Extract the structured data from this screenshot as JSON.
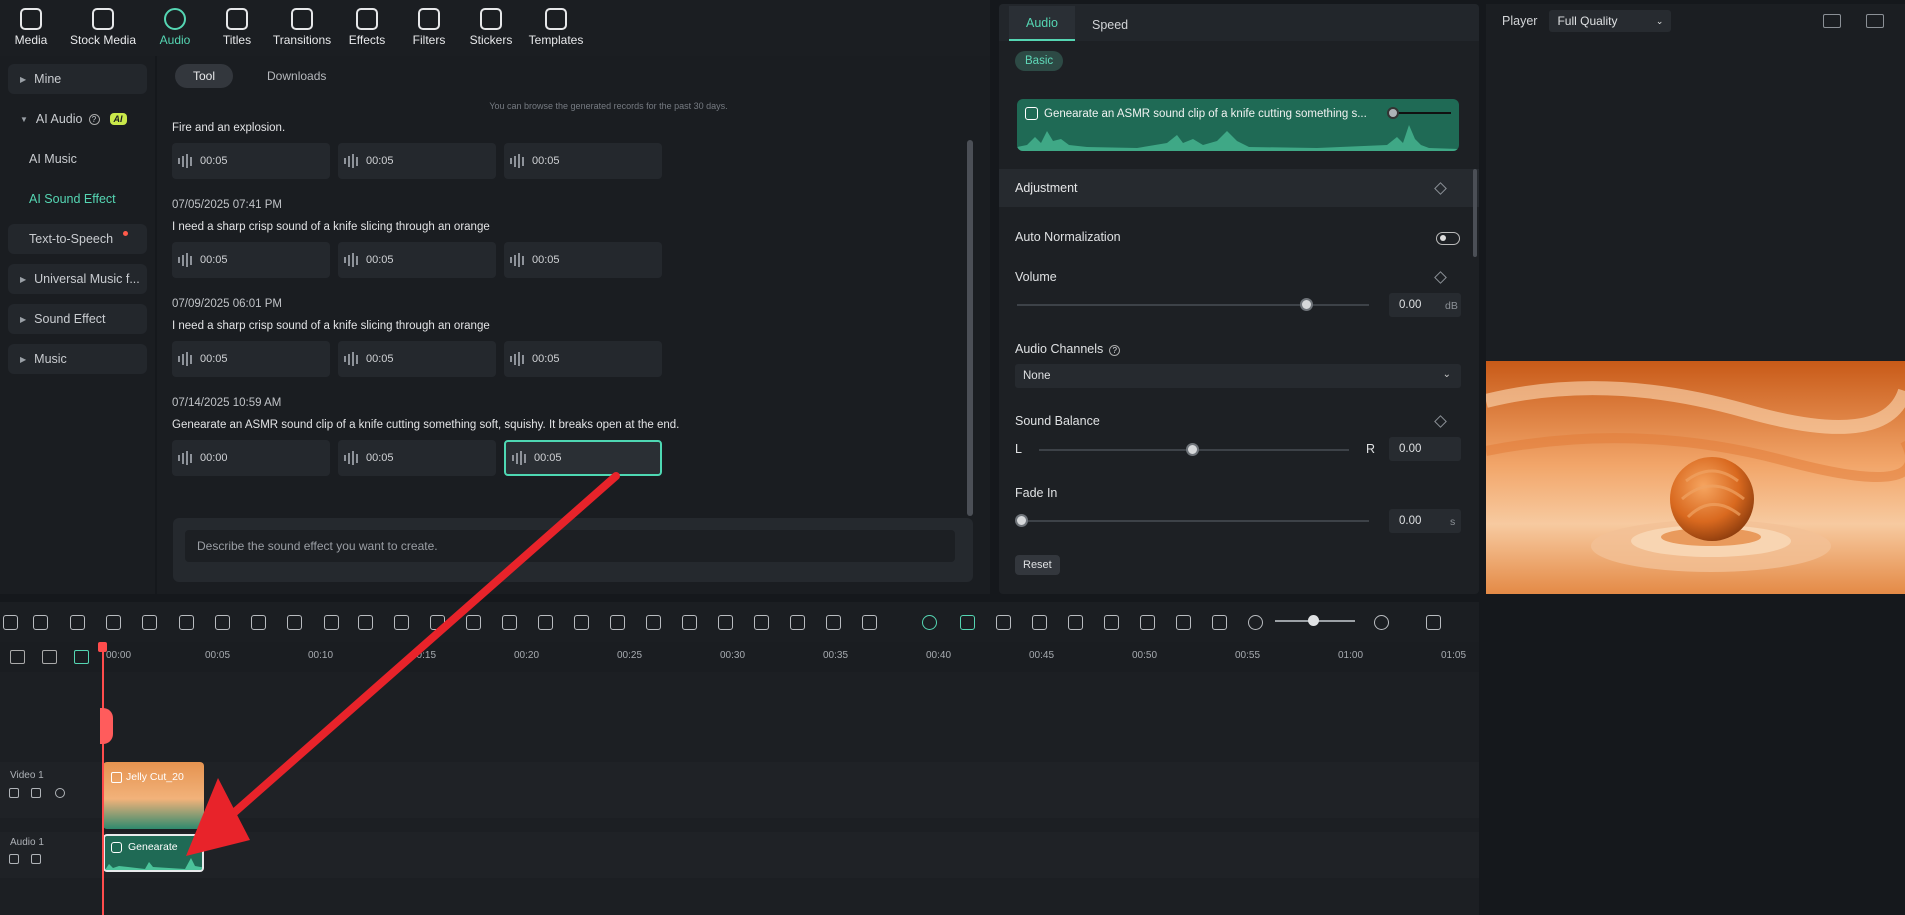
{
  "toolbar": {
    "items": [
      {
        "label": "Media",
        "icon": "media-icon"
      },
      {
        "label": "Stock Media",
        "icon": "stock-media-icon"
      },
      {
        "label": "Audio",
        "icon": "music-note-icon"
      },
      {
        "label": "Titles",
        "icon": "titles-icon"
      },
      {
        "label": "Transitions",
        "icon": "transitions-icon"
      },
      {
        "label": "Effects",
        "icon": "effects-icon"
      },
      {
        "label": "Filters",
        "icon": "filters-icon"
      },
      {
        "label": "Stickers",
        "icon": "stickers-icon"
      },
      {
        "label": "Templates",
        "icon": "templates-icon"
      }
    ],
    "active": "Audio"
  },
  "sidebar": {
    "mine": "Mine",
    "ai_audio": "AI Audio",
    "ai_badge": "AI",
    "ai_music": "AI Music",
    "ai_sound_effect": "AI Sound Effect",
    "tts": "Text-to-Speech",
    "universal_music": "Universal Music f...",
    "sound_effect": "Sound Effect",
    "music": "Music"
  },
  "generator": {
    "tabs": {
      "tool": "Tool",
      "downloads": "Downloads"
    },
    "note": "You can browse the generated records for the past 30 days.",
    "records": [
      {
        "date": "",
        "title": "Fire and an explosion.",
        "clips": [
          "00:05",
          "00:05",
          "00:05"
        ]
      },
      {
        "date": "07/05/2025 07:41 PM",
        "title": "I need a sharp crisp sound of a knife slicing through an orange",
        "clips": [
          "00:05",
          "00:05",
          "00:05"
        ]
      },
      {
        "date": "07/09/2025 06:01 PM",
        "title": "I need a sharp crisp sound of a knife slicing through an orange",
        "clips": [
          "00:05",
          "00:05",
          "00:05"
        ]
      },
      {
        "date": "07/14/2025 10:59 AM",
        "title": "Genearate an ASMR sound clip of a knife cutting something soft, squishy. It breaks open at the end.",
        "clips": [
          "00:00",
          "00:05",
          "00:05"
        ]
      }
    ],
    "prompt_placeholder": "Describe the sound effect you want to create."
  },
  "properties": {
    "tabs": {
      "audio": "Audio",
      "speed": "Speed"
    },
    "basic": "Basic",
    "clip_title": "Genearate an ASMR sound clip of a knife cutting something s...",
    "adjustment": "Adjustment",
    "auto_normalization": "Auto Normalization",
    "volume": {
      "label": "Volume",
      "value": "0.00",
      "unit": "dB"
    },
    "audio_channels": {
      "label": "Audio Channels",
      "value": "None"
    },
    "sound_balance": {
      "label": "Sound Balance",
      "left": "L",
      "right": "R",
      "value": "0.00"
    },
    "fade_in": {
      "label": "Fade In",
      "value": "0.00",
      "unit": "s"
    },
    "reset": "Reset"
  },
  "player": {
    "label": "Player",
    "quality": "Full Quality"
  },
  "timeline": {
    "ticks": [
      "00:00",
      "00:05",
      "00:10",
      "00:15",
      "00:20",
      "00:25",
      "00:30",
      "00:35",
      "00:40",
      "00:45",
      "00:50",
      "00:55",
      "01:00",
      "01:05"
    ],
    "video_track": "Video 1",
    "audio_track": "Audio 1",
    "video_clip": "Jelly Cut_20",
    "audio_clip": "Genearate"
  },
  "colors": {
    "accent": "#55d6b3",
    "playhead": "#ff4c4c",
    "annotation_arrow": "#e8232a"
  }
}
